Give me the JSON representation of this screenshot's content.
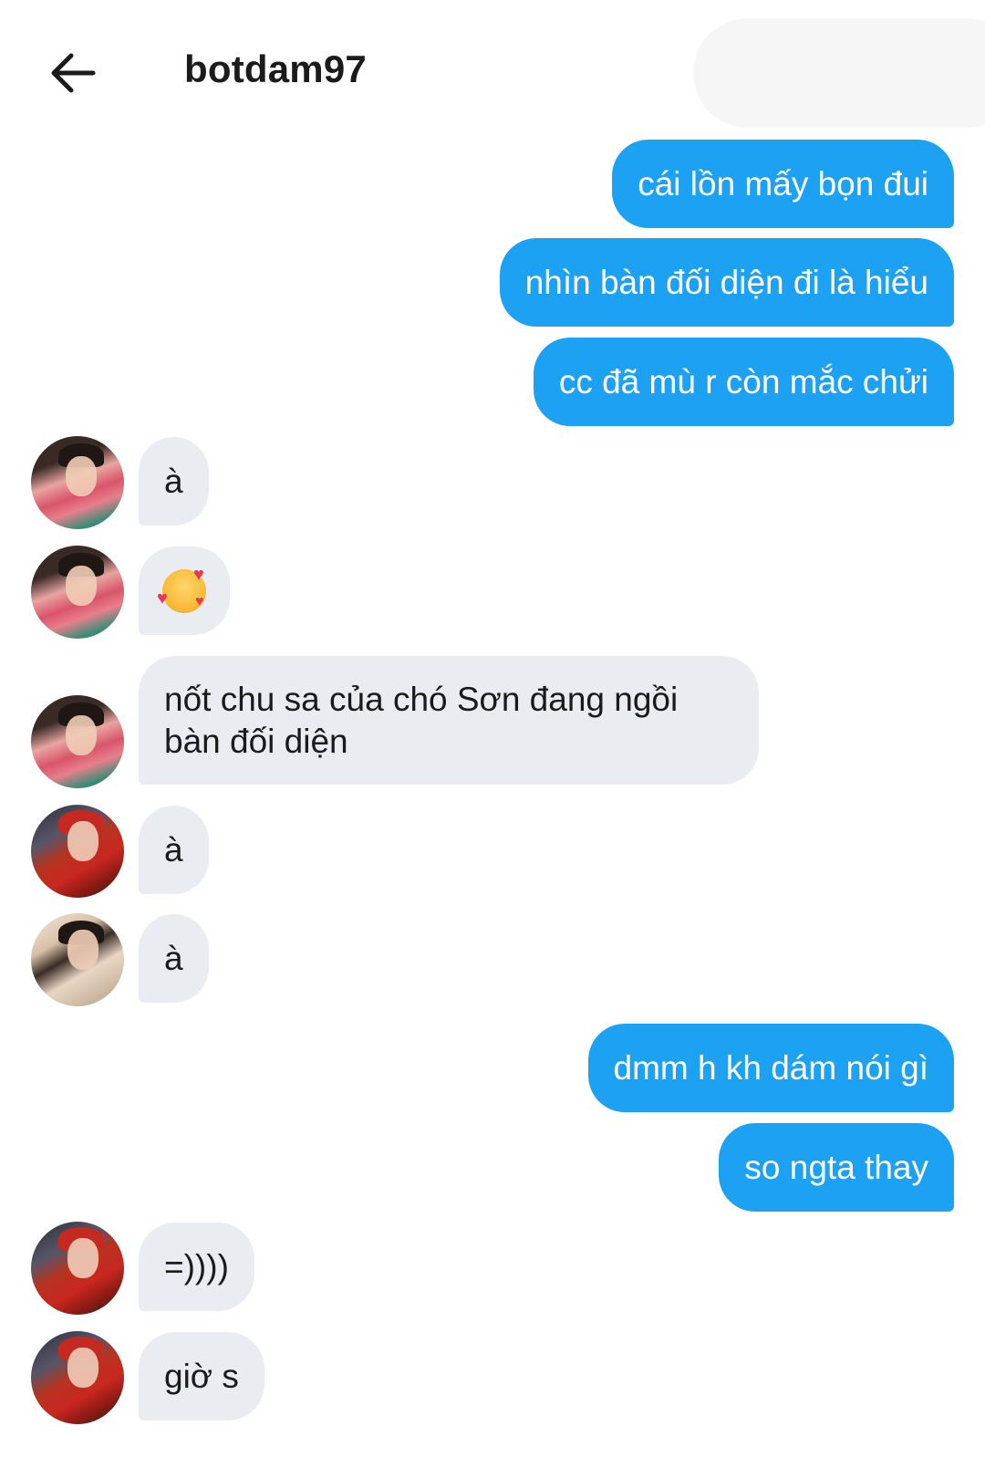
{
  "header": {
    "title": "botdam97",
    "back_icon": "arrow-left-icon"
  },
  "colors": {
    "outgoing_bubble": "#1da1f2",
    "incoming_bubble": "#e9edf1",
    "background": "#ffffff"
  },
  "messages": [
    {
      "direction": "outgoing",
      "text": "cái lồn mấy bọn đui"
    },
    {
      "direction": "outgoing",
      "text": "nhìn bàn đối diện đi là hiểu"
    },
    {
      "direction": "outgoing",
      "text": "cc đã mù r còn mắc chửi"
    },
    {
      "direction": "incoming",
      "avatar": "avatar-person-1",
      "text": "à"
    },
    {
      "direction": "incoming",
      "avatar": "avatar-person-1",
      "text": "🥰",
      "icon": "smiling-face-with-hearts-emoji"
    },
    {
      "direction": "incoming",
      "avatar": "avatar-person-1",
      "lines": [
        "nốt chu sa của chó Sơn đang ngồi",
        "bàn đối diện"
      ]
    },
    {
      "direction": "incoming",
      "avatar": "avatar-person-2",
      "text": "à"
    },
    {
      "direction": "incoming",
      "avatar": "avatar-person-3",
      "text": "à"
    },
    {
      "direction": "outgoing",
      "text": "dmm h kh dám nói gì"
    },
    {
      "direction": "outgoing",
      "text": "so ngta thay"
    },
    {
      "direction": "incoming",
      "avatar": "avatar-person-2",
      "text": "=))))"
    },
    {
      "direction": "incoming",
      "avatar": "avatar-person-2",
      "text": "giờ s"
    }
  ]
}
